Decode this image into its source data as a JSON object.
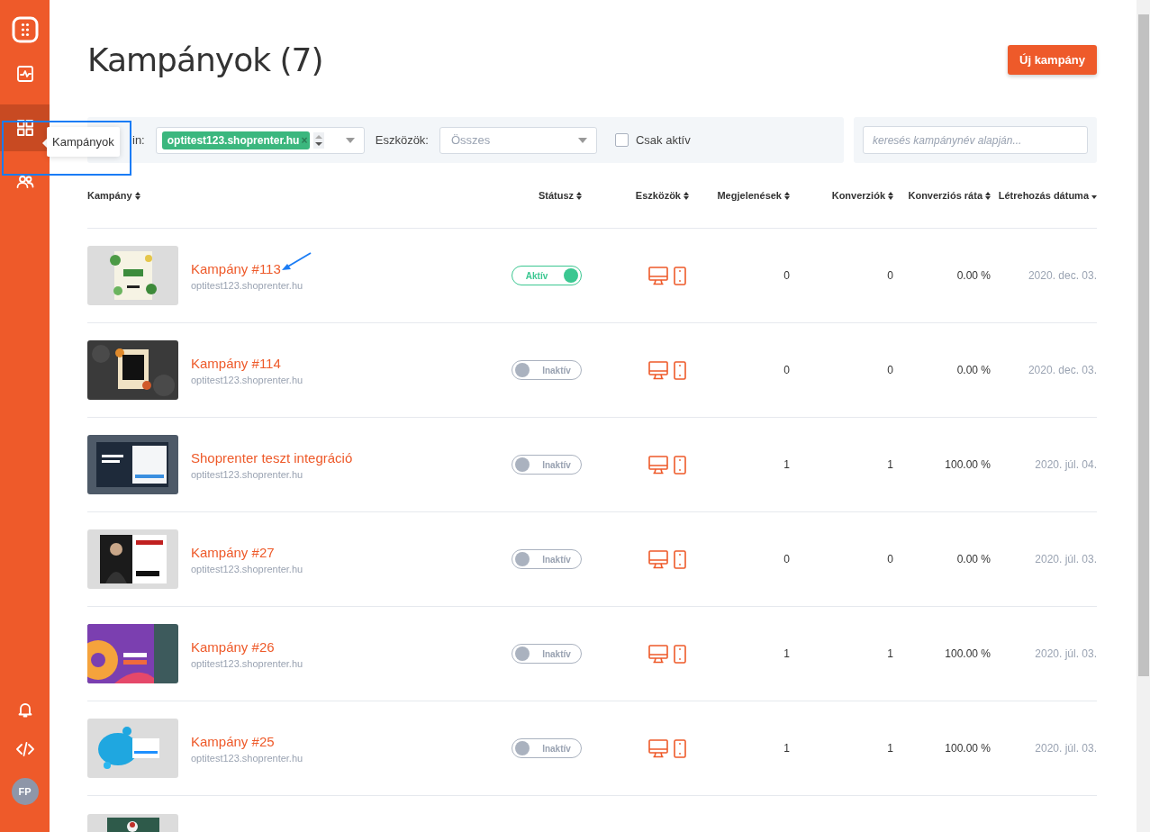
{
  "sidebar": {
    "items": [
      {
        "kind": "activity",
        "selected": false
      },
      {
        "kind": "grid",
        "selected": true
      },
      {
        "kind": "users",
        "selected": false
      }
    ],
    "bottom_items": [
      {
        "kind": "bell"
      },
      {
        "kind": "code"
      }
    ],
    "avatar": "FP",
    "tooltip": "Kampányok"
  },
  "header": {
    "title": "Kampányok (7)",
    "new_button": "Új kampány"
  },
  "filters": {
    "domain_label": "in:",
    "domain_tag": "optitest123.shoprenter.hu",
    "tag_remove": "×",
    "devices_label": "Eszközök:",
    "devices_placeholder": "Összes",
    "only_active": {
      "label": "Csak aktív",
      "checked": false
    },
    "search_placeholder": "keresés kampánynév alapján..."
  },
  "table": {
    "columns": [
      {
        "label": "Kampány",
        "sorted": false
      },
      {
        "label": "Státusz",
        "sorted": false
      },
      {
        "label": "Eszközök",
        "sorted": false
      },
      {
        "label": "Megjelenések",
        "sorted": false
      },
      {
        "label": "Konverziók",
        "sorted": false
      },
      {
        "label": "Konverziós ráta",
        "sorted": false
      },
      {
        "label": "Létrehozás dátuma",
        "sorted": true
      }
    ],
    "rows": [
      {
        "name": "Kampány #113",
        "domain": "optitest123.shoprenter.hu",
        "status": {
          "label": "Aktív",
          "on": true
        },
        "impressions": "0",
        "conversions": "0",
        "rate": "0.00 %",
        "created": "2020. dec. 03."
      },
      {
        "name": "Kampány #114",
        "domain": "optitest123.shoprenter.hu",
        "status": {
          "label": "Inaktív",
          "on": false
        },
        "impressions": "0",
        "conversions": "0",
        "rate": "0.00 %",
        "created": "2020. dec. 03."
      },
      {
        "name": "Shoprenter teszt integráció",
        "domain": "optitest123.shoprenter.hu",
        "status": {
          "label": "Inaktív",
          "on": false
        },
        "impressions": "1",
        "conversions": "1",
        "rate": "100.00 %",
        "created": "2020. júl. 04."
      },
      {
        "name": "Kampány #27",
        "domain": "optitest123.shoprenter.hu",
        "status": {
          "label": "Inaktív",
          "on": false
        },
        "impressions": "0",
        "conversions": "0",
        "rate": "0.00 %",
        "created": "2020. júl. 03."
      },
      {
        "name": "Kampány #26",
        "domain": "optitest123.shoprenter.hu",
        "status": {
          "label": "Inaktív",
          "on": false
        },
        "impressions": "1",
        "conversions": "1",
        "rate": "100.00 %",
        "created": "2020. júl. 03."
      },
      {
        "name": "Kampány #25",
        "domain": "optitest123.shoprenter.hu",
        "status": {
          "label": "Inaktív",
          "on": false
        },
        "impressions": "1",
        "conversions": "1",
        "rate": "100.00 %",
        "created": "2020. júl. 03."
      }
    ]
  },
  "annotations": {
    "highlight_frame": true,
    "arrow": true
  }
}
